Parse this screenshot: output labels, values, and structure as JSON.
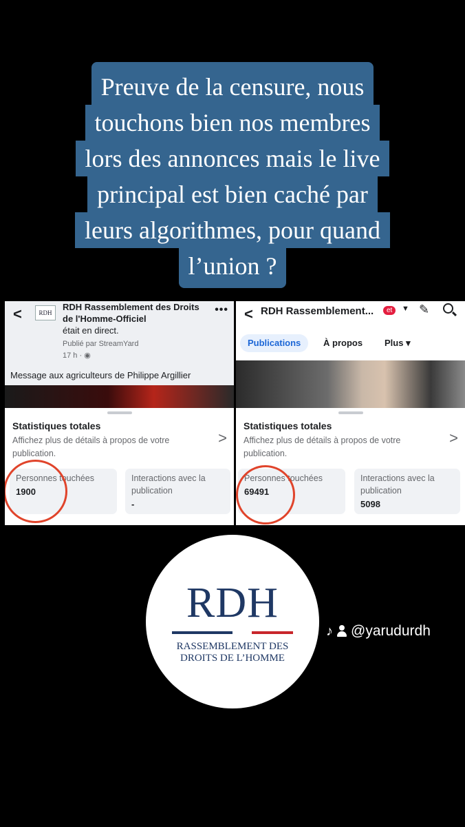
{
  "caption": {
    "lines": [
      "Preuve de la censure, nous",
      "touchons bien nos membres",
      "lors des annonces mais le live",
      "principal est bien caché par",
      "leurs algorithmes, pour quand",
      "l’union ?"
    ]
  },
  "left_panel": {
    "logo_text": "RDH",
    "page_name": "RDH Rassemblement des Droits de l'Homme-Officiel",
    "live_status": "était en direct.",
    "published_by": "Publié par StreamYard",
    "time": "17 h ·",
    "post_message": "Message aux agriculteurs de Philippe Argillier",
    "stats_title": "Statistiques totales",
    "stats_description": "Affichez plus de détails à propos de votre publication.",
    "reach_label": "Personnes touchées",
    "reach_value": "1900",
    "interactions_label": "Interactions avec la publication",
    "interactions_value": "-"
  },
  "right_panel": {
    "page_title": "RDH Rassemblement...",
    "badge": "et",
    "tabs": [
      "Publications",
      "À propos",
      "Plus ▾"
    ],
    "active_tab": "Publications",
    "stats_title": "Statistiques totales",
    "stats_description": "Affichez plus de détails à propos de votre publication.",
    "reach_label": "Personnes touchées",
    "reach_value": "69491",
    "interactions_label": "Interactions avec la publication",
    "interactions_value": "5098"
  },
  "logo": {
    "mark": "RDH",
    "subtitle_line1": "RASSEMBLEMENT DES",
    "subtitle_line2": "DROITS DE L’HOMME"
  },
  "social": {
    "handle": "@yarudurdh",
    "icons": [
      "tiktok-icon",
      "person-icon"
    ]
  },
  "colors": {
    "caption_bg": "#35658f",
    "circle_mark": "#e0442b",
    "logo_blue": "#1f3864",
    "logo_red": "#c8262b",
    "fb_blue": "#1b66d6"
  }
}
